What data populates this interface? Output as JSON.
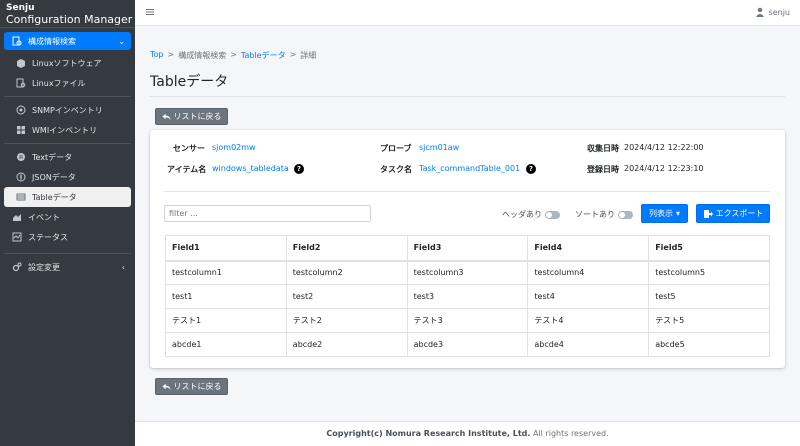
{
  "brand": {
    "line1": "Senju",
    "line2": "Configuration Manager"
  },
  "sidebar": {
    "parent": {
      "label": "構成情報検索",
      "icon": "search-list-icon"
    },
    "items": [
      {
        "label": "Linuxソフトウェア",
        "icon": "package-icon"
      },
      {
        "label": "Linuxファイル",
        "icon": "file-search-icon"
      },
      {
        "label": "SNMPインベントリ",
        "icon": "network-icon"
      },
      {
        "label": "WMIインベントリ",
        "icon": "windows-icon"
      },
      {
        "label": "Textデータ",
        "icon": "text-icon"
      },
      {
        "label": "JSONデータ",
        "icon": "json-icon"
      },
      {
        "label": "Tableデータ",
        "icon": "table-icon"
      },
      {
        "label": "イベント",
        "icon": "chart-area-icon"
      },
      {
        "label": "ステータス",
        "icon": "status-icon"
      }
    ],
    "settings": {
      "label": "設定変更",
      "icon": "cogs-icon"
    }
  },
  "topbar": {
    "user": "senju"
  },
  "breadcrumb": {
    "top": "Top",
    "sep": ">",
    "level1": "構成情報検索",
    "level2": "Tableデータ",
    "level3": "詳細"
  },
  "page_title": "Tableデータ",
  "back_button": "リストに戻る",
  "info": {
    "sensor_label": "センサー",
    "sensor_value": "sjom02mw",
    "probe_label": "プローブ",
    "probe_value": "sjcm01aw",
    "collected_label": "収集日時",
    "collected_value": "2024/4/12 12:22:00",
    "item_label": "アイテム名",
    "item_value": "windows_tabledata",
    "task_label": "タスク名",
    "task_value": "Task_commandTable_001",
    "registered_label": "登録日時",
    "registered_value": "2024/4/12 12:23:10",
    "help": "?"
  },
  "controls": {
    "filter_placeholder": "filter ...",
    "header_toggle": "ヘッダあり",
    "sort_toggle": "ソートあり",
    "columns_button": "列表示",
    "export_button": "エクスポート"
  },
  "table": {
    "headers": [
      "Field1",
      "Field2",
      "Field3",
      "Field4",
      "Field5"
    ],
    "rows": [
      [
        "testcolumn1",
        "testcolumn2",
        "testcolumn3",
        "testcolumn4",
        "testcolumn5"
      ],
      [
        "test1",
        "test2",
        "test3",
        "test4",
        "test5"
      ],
      [
        "テスト1",
        "テスト2",
        "テスト3",
        "テスト4",
        "テスト5"
      ],
      [
        "abcde1",
        "abcde2",
        "abcde3",
        "abcde4",
        "abcde5"
      ]
    ]
  },
  "footer": {
    "copyright": "Copyright(c) Nomura Research Institute, Ltd.",
    "rights": "All rights reserved."
  },
  "colors": {
    "primary": "#007bff",
    "sidebar": "#343a40",
    "secondary": "#6c757d"
  }
}
